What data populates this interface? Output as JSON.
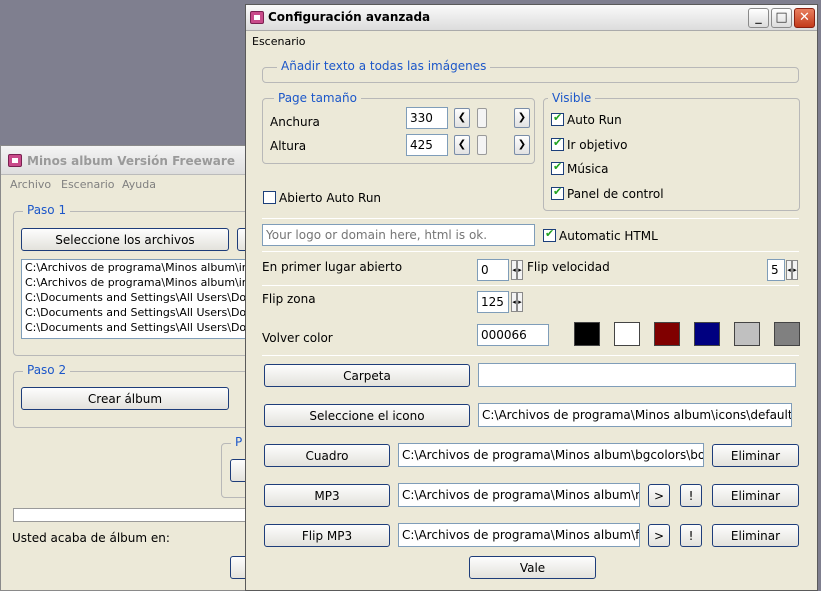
{
  "background_window": {
    "title": "Minos album  Versión Freeware",
    "menu": [
      "Archivo",
      "Escenario",
      "Ayuda"
    ],
    "paso1_label": "Paso 1",
    "select_files_button": "Seleccione los archivos",
    "files": [
      "C:\\Archivos de programa\\Minos album\\ir",
      "C:\\Archivos de programa\\Minos album\\ir",
      "C:\\Documents and Settings\\All Users\\Do",
      "C:\\Documents and Settings\\All Users\\Do",
      "C:\\Documents and Settings\\All Users\\Do"
    ],
    "paso2_label": "Paso 2",
    "create_album_button": "Crear álbum",
    "partial_group_label": "P",
    "status_text": "Usted acaba de álbum en:"
  },
  "dialog": {
    "title": "Configuración avanzada",
    "menu": [
      "Escenario"
    ],
    "add_text_group": "Añadir texto a todas las imágenes",
    "page_size_group": "Page tamaño",
    "width_label": "Anchura",
    "width_value": "330",
    "height_label": "Altura",
    "height_value": "425",
    "visible_group": "Visible",
    "visible_options": [
      {
        "label": "Auto Run",
        "checked": true
      },
      {
        "label": "Ir objetivo",
        "checked": true
      },
      {
        "label": "Música",
        "checked": true
      },
      {
        "label": "Panel de control",
        "checked": true
      }
    ],
    "open_autorun_label": "Abierto Auto Run",
    "open_autorun_checked": false,
    "logo_placeholder": "Your logo or domain here, html is ok.",
    "automatic_html_label": "Automatic HTML",
    "automatic_html_checked": true,
    "first_open_label": "En primer lugar abierto",
    "first_open_value": "0",
    "flip_speed_label": "Flip velocidad",
    "flip_speed_value": "5",
    "flip_zone_label": "Flip zona",
    "flip_zone_value": "125",
    "back_color_label": "Volver color",
    "back_color_value": "000066",
    "swatches": [
      "#000000",
      "#ffffff",
      "#800000",
      "#000080",
      "#c0c0c0",
      "#808080"
    ],
    "folder_button": "Carpeta",
    "folder_value": "",
    "icon_button": "Seleccione el icono",
    "icon_value": "C:\\Archivos de programa\\Minos album\\icons\\default.ic",
    "frame_button": "Cuadro",
    "frame_value": "C:\\Archivos de programa\\Minos album\\bgcolors\\boo",
    "delete_label": "Eliminar",
    "mp3_button": "MP3",
    "mp3_value": "C:\\Archivos de programa\\Minos album\\m",
    "play_label": ">",
    "stop_label": "!",
    "flip_mp3_button": "Flip MP3",
    "flip_mp3_value": "C:\\Archivos de programa\\Minos album\\fs",
    "ok_button": "Vale"
  }
}
